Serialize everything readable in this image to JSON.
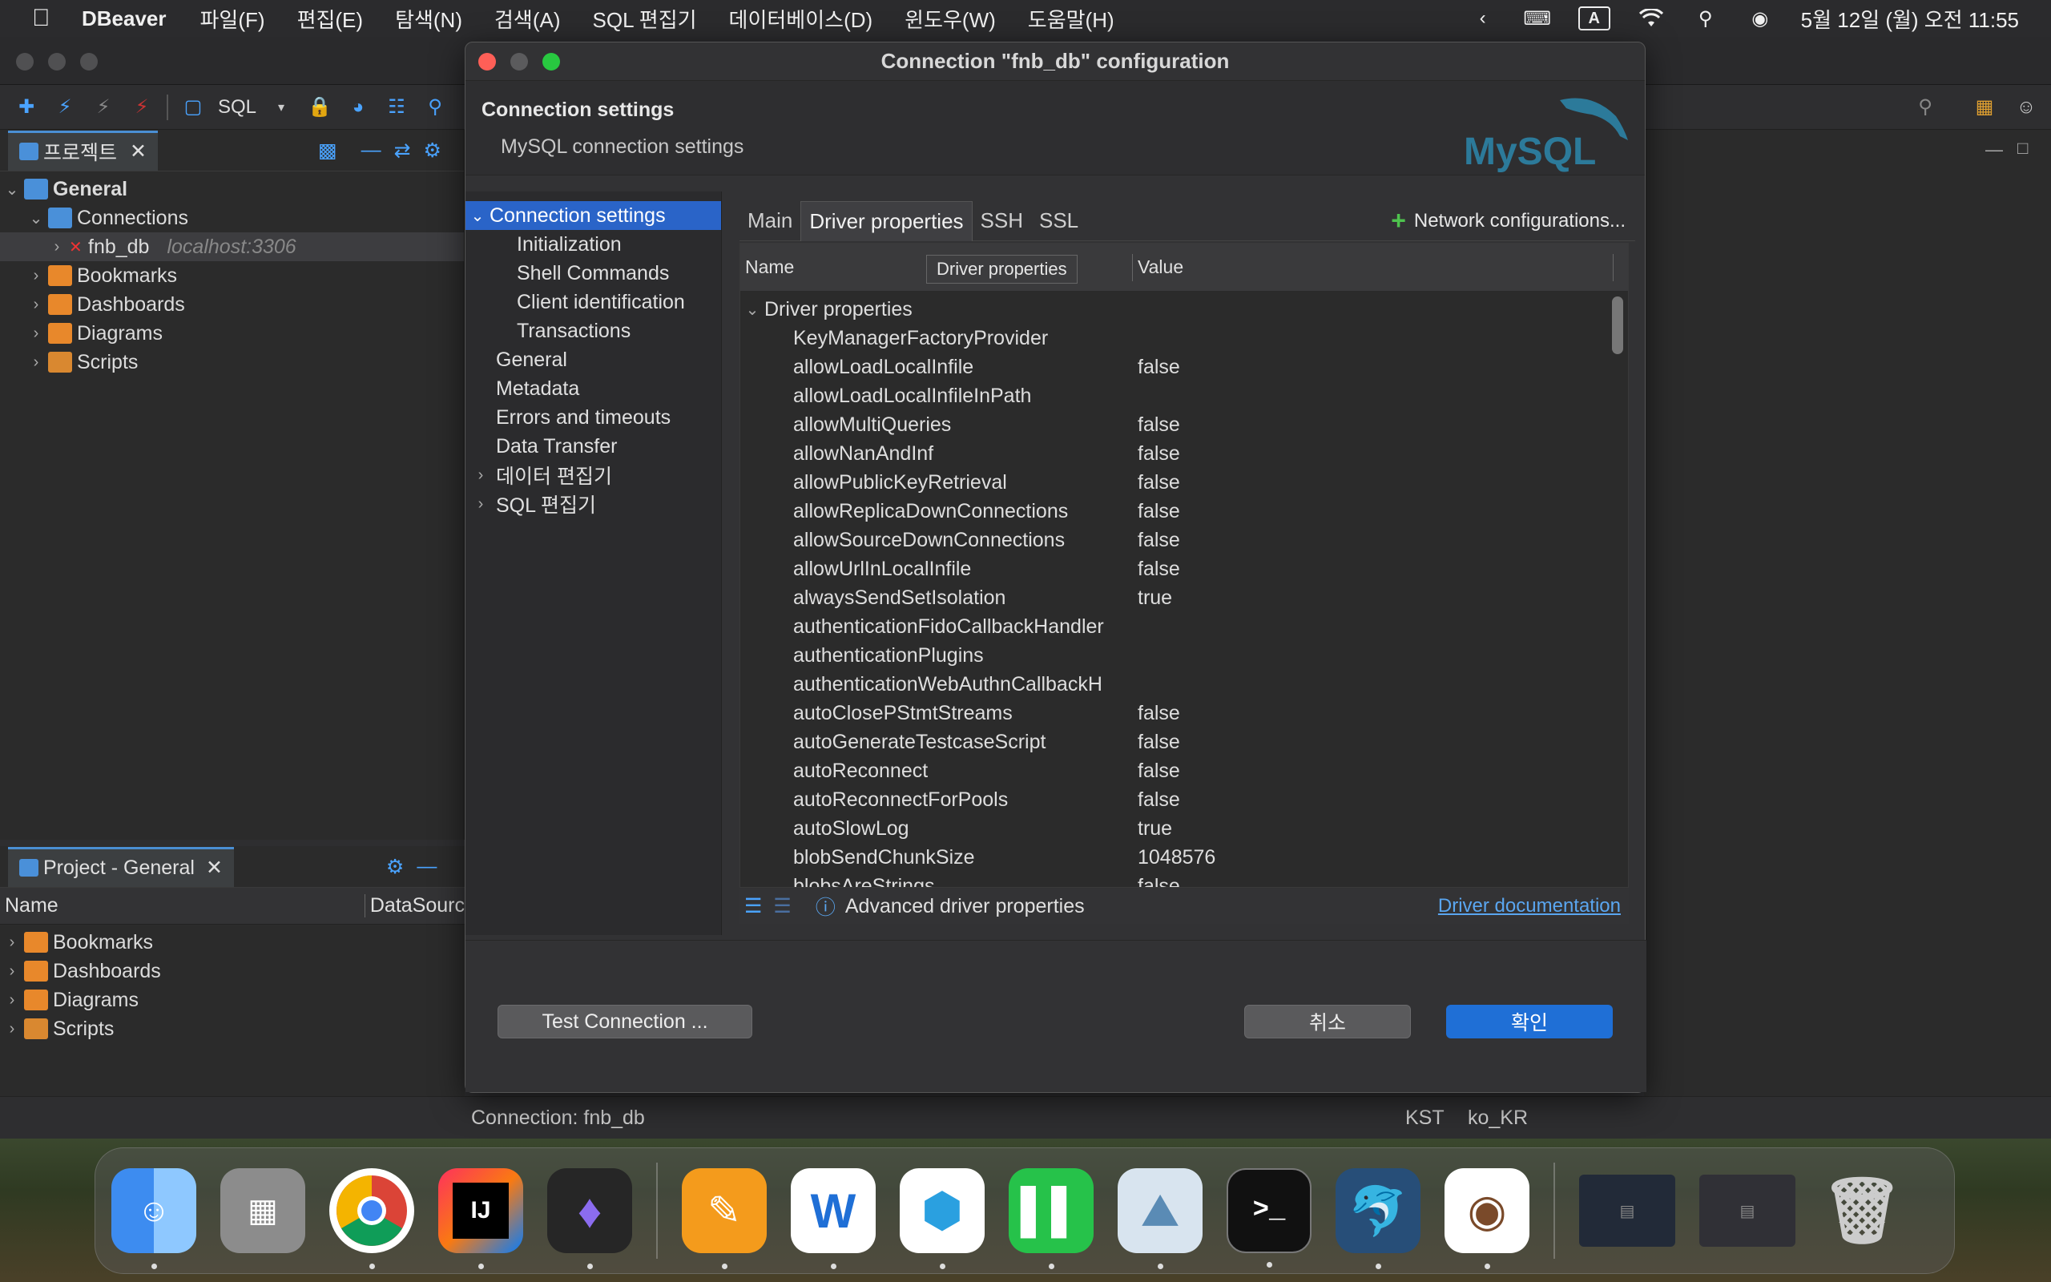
{
  "menubar": {
    "app": "DBeaver",
    "items": [
      "파일(F)",
      "편집(E)",
      "탐색(N)",
      "검색(A)",
      "SQL 편집기",
      "데이터베이스(D)",
      "윈도우(W)",
      "도움말(H)"
    ],
    "clock": "5월 12일 (월) 오전 11:55",
    "input_indicator": "A"
  },
  "toolbar": {
    "sql_label": "SQL"
  },
  "project_panel": {
    "tab_label": "프로젝트",
    "tree": {
      "root": "General",
      "connections": "Connections",
      "connection_name": "fnb_db",
      "connection_host": "localhost:3306",
      "bookmarks": "Bookmarks",
      "dashboards": "Dashboards",
      "diagrams": "Diagrams",
      "scripts": "Scripts"
    }
  },
  "project_general": {
    "tab_label": "Project - General",
    "col_name": "Name",
    "col_datasource": "DataSourc",
    "items": [
      "Bookmarks",
      "Dashboards",
      "Diagrams",
      "Scripts"
    ]
  },
  "statusbar": {
    "connection": "Connection: fnb_db",
    "timezone": "KST",
    "locale": "ko_KR"
  },
  "dialog": {
    "title": "Connection \"fnb_db\" configuration",
    "header_title": "Connection settings",
    "header_subtitle": "MySQL connection settings",
    "logo_text": "MySQL",
    "nav": {
      "connection_settings": "Connection settings",
      "children": [
        "Initialization",
        "Shell Commands",
        "Client identification",
        "Transactions"
      ],
      "items": [
        "General",
        "Metadata",
        "Errors and timeouts",
        "Data Transfer"
      ],
      "expandable": [
        "데이터 편집기",
        "SQL 편집기"
      ]
    },
    "tabs": [
      "Main",
      "Driver properties",
      "SSH",
      "SSL"
    ],
    "active_tab": "Driver properties",
    "network_config": "Network configurations...",
    "grid": {
      "col_name": "Name",
      "col_value": "Value",
      "tooltip": "Driver properties",
      "group": "Driver properties",
      "rows": [
        {
          "name": "KeyManagerFactoryProvider",
          "value": ""
        },
        {
          "name": "allowLoadLocalInfile",
          "value": "false"
        },
        {
          "name": "allowLoadLocalInfileInPath",
          "value": ""
        },
        {
          "name": "allowMultiQueries",
          "value": "false"
        },
        {
          "name": "allowNanAndInf",
          "value": "false"
        },
        {
          "name": "allowPublicKeyRetrieval",
          "value": "false"
        },
        {
          "name": "allowReplicaDownConnections",
          "value": "false"
        },
        {
          "name": "allowSourceDownConnections",
          "value": "false"
        },
        {
          "name": "allowUrlInLocalInfile",
          "value": "false"
        },
        {
          "name": "alwaysSendSetIsolation",
          "value": "true"
        },
        {
          "name": "authenticationFidoCallbackHandler",
          "value": ""
        },
        {
          "name": "authenticationPlugins",
          "value": ""
        },
        {
          "name": "authenticationWebAuthnCallbackH",
          "value": ""
        },
        {
          "name": "autoClosePStmtStreams",
          "value": "false"
        },
        {
          "name": "autoGenerateTestcaseScript",
          "value": "false"
        },
        {
          "name": "autoReconnect",
          "value": "false"
        },
        {
          "name": "autoReconnectForPools",
          "value": "false"
        },
        {
          "name": "autoSlowLog",
          "value": "true"
        },
        {
          "name": "blobSendChunkSize",
          "value": "1048576"
        },
        {
          "name": "blobsAreStrings",
          "value": "false"
        }
      ]
    },
    "advanced_label": "Advanced driver properties",
    "driver_doc_link": "Driver documentation",
    "test_button": "Test Connection ...",
    "cancel_button": "취소",
    "ok_button": "확인"
  },
  "dock": {
    "apps": [
      "Finder",
      "Launchpad",
      "Chrome",
      "IntelliJ IDEA",
      "Obsidian",
      "Pages",
      "Naver Whale",
      "Naver MYBOX",
      "Numbers",
      "Preview",
      "Terminal",
      "DBeaver",
      "DBeaver CE",
      "Trash"
    ]
  },
  "colors": {
    "accent": "#2a64c8",
    "ok_button": "#1f6fd6",
    "link": "#5aa6f0",
    "close": "#fe5f57",
    "zoom": "#28c840"
  }
}
